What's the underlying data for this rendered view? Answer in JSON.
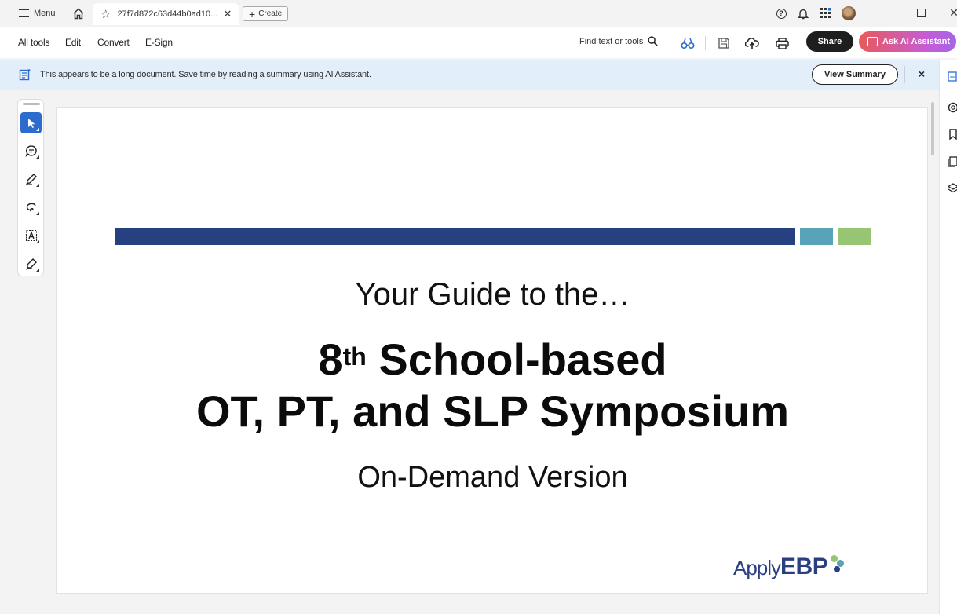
{
  "titlebar": {
    "menu_label": "Menu",
    "tab_title": "27f7d872c63d44b0ad10...",
    "create_label": "Create"
  },
  "toolbar": {
    "menus": [
      "All tools",
      "Edit",
      "Convert",
      "E-Sign"
    ],
    "find_label": "Find text or tools",
    "share_label": "Share",
    "ai_label": "Ask AI Assistant"
  },
  "banner": {
    "message": "This appears to be a long document. Save time by reading a summary using AI Assistant.",
    "button_label": "View Summary",
    "close_label": "×"
  },
  "document": {
    "subtitle": "Your Guide to the…",
    "title_number": "8",
    "title_sup": "th",
    "title_rest": " School-based",
    "title_line2": "OT, PT, and SLP Symposium",
    "version": "On-Demand Version",
    "logo_apply": "Apply",
    "logo_ebp": "EBP"
  },
  "colors": {
    "bar_blue": "#274180",
    "bar_teal": "#59a3b9",
    "bar_green": "#98c574",
    "accent": "#2d6ccf"
  }
}
